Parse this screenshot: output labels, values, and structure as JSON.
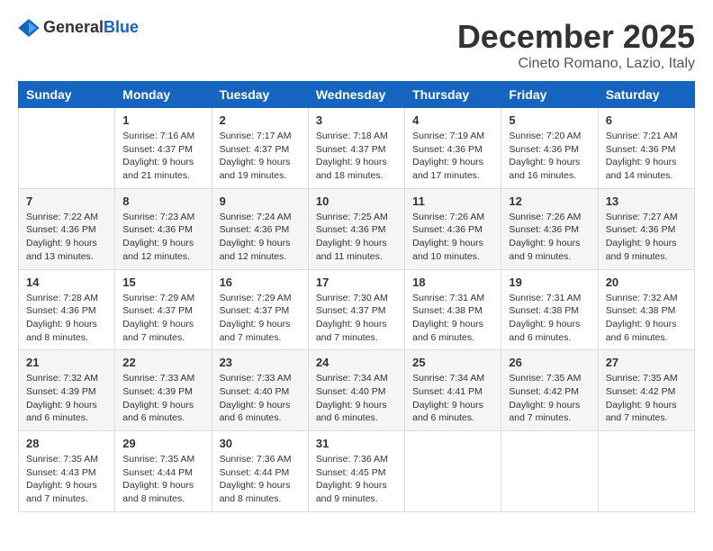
{
  "header": {
    "logo_general": "General",
    "logo_blue": "Blue",
    "month_title": "December 2025",
    "location": "Cineto Romano, Lazio, Italy"
  },
  "days_of_week": [
    "Sunday",
    "Monday",
    "Tuesday",
    "Wednesday",
    "Thursday",
    "Friday",
    "Saturday"
  ],
  "weeks": [
    [
      {
        "day": "",
        "info": ""
      },
      {
        "day": "1",
        "info": "Sunrise: 7:16 AM\nSunset: 4:37 PM\nDaylight: 9 hours\nand 21 minutes."
      },
      {
        "day": "2",
        "info": "Sunrise: 7:17 AM\nSunset: 4:37 PM\nDaylight: 9 hours\nand 19 minutes."
      },
      {
        "day": "3",
        "info": "Sunrise: 7:18 AM\nSunset: 4:37 PM\nDaylight: 9 hours\nand 18 minutes."
      },
      {
        "day": "4",
        "info": "Sunrise: 7:19 AM\nSunset: 4:36 PM\nDaylight: 9 hours\nand 17 minutes."
      },
      {
        "day": "5",
        "info": "Sunrise: 7:20 AM\nSunset: 4:36 PM\nDaylight: 9 hours\nand 16 minutes."
      },
      {
        "day": "6",
        "info": "Sunrise: 7:21 AM\nSunset: 4:36 PM\nDaylight: 9 hours\nand 14 minutes."
      }
    ],
    [
      {
        "day": "7",
        "info": "Sunrise: 7:22 AM\nSunset: 4:36 PM\nDaylight: 9 hours\nand 13 minutes."
      },
      {
        "day": "8",
        "info": "Sunrise: 7:23 AM\nSunset: 4:36 PM\nDaylight: 9 hours\nand 12 minutes."
      },
      {
        "day": "9",
        "info": "Sunrise: 7:24 AM\nSunset: 4:36 PM\nDaylight: 9 hours\nand 12 minutes."
      },
      {
        "day": "10",
        "info": "Sunrise: 7:25 AM\nSunset: 4:36 PM\nDaylight: 9 hours\nand 11 minutes."
      },
      {
        "day": "11",
        "info": "Sunrise: 7:26 AM\nSunset: 4:36 PM\nDaylight: 9 hours\nand 10 minutes."
      },
      {
        "day": "12",
        "info": "Sunrise: 7:26 AM\nSunset: 4:36 PM\nDaylight: 9 hours\nand 9 minutes."
      },
      {
        "day": "13",
        "info": "Sunrise: 7:27 AM\nSunset: 4:36 PM\nDaylight: 9 hours\nand 9 minutes."
      }
    ],
    [
      {
        "day": "14",
        "info": "Sunrise: 7:28 AM\nSunset: 4:36 PM\nDaylight: 9 hours\nand 8 minutes."
      },
      {
        "day": "15",
        "info": "Sunrise: 7:29 AM\nSunset: 4:37 PM\nDaylight: 9 hours\nand 7 minutes."
      },
      {
        "day": "16",
        "info": "Sunrise: 7:29 AM\nSunset: 4:37 PM\nDaylight: 9 hours\nand 7 minutes."
      },
      {
        "day": "17",
        "info": "Sunrise: 7:30 AM\nSunset: 4:37 PM\nDaylight: 9 hours\nand 7 minutes."
      },
      {
        "day": "18",
        "info": "Sunrise: 7:31 AM\nSunset: 4:38 PM\nDaylight: 9 hours\nand 6 minutes."
      },
      {
        "day": "19",
        "info": "Sunrise: 7:31 AM\nSunset: 4:38 PM\nDaylight: 9 hours\nand 6 minutes."
      },
      {
        "day": "20",
        "info": "Sunrise: 7:32 AM\nSunset: 4:38 PM\nDaylight: 9 hours\nand 6 minutes."
      }
    ],
    [
      {
        "day": "21",
        "info": "Sunrise: 7:32 AM\nSunset: 4:39 PM\nDaylight: 9 hours\nand 6 minutes."
      },
      {
        "day": "22",
        "info": "Sunrise: 7:33 AM\nSunset: 4:39 PM\nDaylight: 9 hours\nand 6 minutes."
      },
      {
        "day": "23",
        "info": "Sunrise: 7:33 AM\nSunset: 4:40 PM\nDaylight: 9 hours\nand 6 minutes."
      },
      {
        "day": "24",
        "info": "Sunrise: 7:34 AM\nSunset: 4:40 PM\nDaylight: 9 hours\nand 6 minutes."
      },
      {
        "day": "25",
        "info": "Sunrise: 7:34 AM\nSunset: 4:41 PM\nDaylight: 9 hours\nand 6 minutes."
      },
      {
        "day": "26",
        "info": "Sunrise: 7:35 AM\nSunset: 4:42 PM\nDaylight: 9 hours\nand 7 minutes."
      },
      {
        "day": "27",
        "info": "Sunrise: 7:35 AM\nSunset: 4:42 PM\nDaylight: 9 hours\nand 7 minutes."
      }
    ],
    [
      {
        "day": "28",
        "info": "Sunrise: 7:35 AM\nSunset: 4:43 PM\nDaylight: 9 hours\nand 7 minutes."
      },
      {
        "day": "29",
        "info": "Sunrise: 7:35 AM\nSunset: 4:44 PM\nDaylight: 9 hours\nand 8 minutes."
      },
      {
        "day": "30",
        "info": "Sunrise: 7:36 AM\nSunset: 4:44 PM\nDaylight: 9 hours\nand 8 minutes."
      },
      {
        "day": "31",
        "info": "Sunrise: 7:36 AM\nSunset: 4:45 PM\nDaylight: 9 hours\nand 9 minutes."
      },
      {
        "day": "",
        "info": ""
      },
      {
        "day": "",
        "info": ""
      },
      {
        "day": "",
        "info": ""
      }
    ]
  ]
}
